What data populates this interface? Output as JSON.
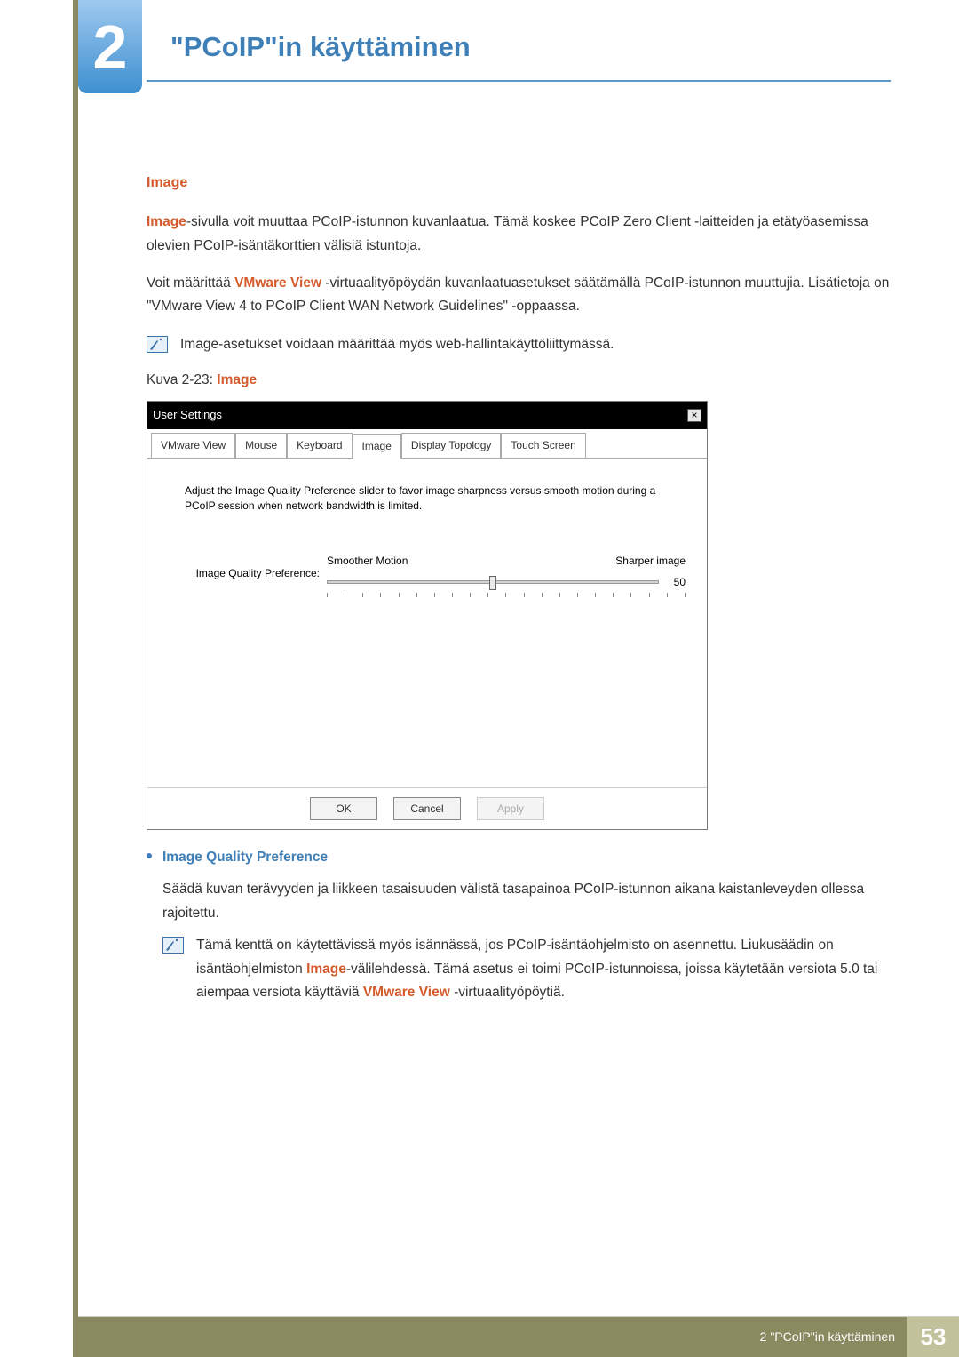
{
  "chapter": {
    "number": "2",
    "title": "\"PCoIP\"in käyttäminen"
  },
  "section": {
    "heading": "Image"
  },
  "para1_a": "Image",
  "para1_b": "-sivulla voit muuttaa PCoIP-istunnon kuvanlaatua. Tämä koskee PCoIP Zero Client -laitteiden ja etätyöasemissa olevien PCoIP-isäntäkorttien välisiä istuntoja.",
  "para2_a": "Voit määrittää ",
  "para2_b": "VMware View",
  "para2_c": " -virtuaalityöpöydän kuvanlaatuasetukset säätämällä PCoIP-istunnon muuttujia. Lisätietoja on \"VMware View 4 to PCoIP Client WAN Network Guidelines\" -oppaassa.",
  "note1": "Image-asetukset voidaan määrittää myös web-hallintakäyttöliittymässä.",
  "fig_cap_a": "Kuva 2-23: ",
  "fig_cap_b": "Image",
  "dialog": {
    "title": "User Settings",
    "close": "×",
    "tabs": [
      "VMware View",
      "Mouse",
      "Keyboard",
      "Image",
      "Display Topology",
      "Touch Screen"
    ],
    "active_tab_index": 3,
    "desc": "Adjust the Image Quality Preference slider to favor image sharpness versus smooth motion during a PCoIP session when network bandwidth is limited.",
    "slider": {
      "label": "Image Quality Preference:",
      "left": "Smoother Motion",
      "right": "Sharper image",
      "value": "50"
    },
    "buttons": {
      "ok": "OK",
      "cancel": "Cancel",
      "apply": "Apply"
    }
  },
  "bullet": {
    "title": "Image Quality Preference"
  },
  "bullet_para": "Säädä kuvan terävyyden ja liikkeen tasaisuuden välistä tasapainoa PCoIP-istunnon aikana kaistanleveyden ollessa rajoitettu.",
  "note2_a": "Tämä kenttä on käytettävissä myös isännässä, jos PCoIP-isäntäohjelmisto on asennettu. Liukusäädin on isäntäohjelmiston ",
  "note2_b": "Image",
  "note2_c": "-välilehdessä. Tämä asetus ei toimi PCoIP-istunnoissa, joissa käytetään versiota 5.0 tai aiempaa versiota käyttäviä ",
  "note2_d": "VMware View",
  "note2_e": " -virtuaalityöpöytiä.",
  "footer": {
    "text": "2 \"PCoIP\"in käyttäminen",
    "page": "53"
  }
}
